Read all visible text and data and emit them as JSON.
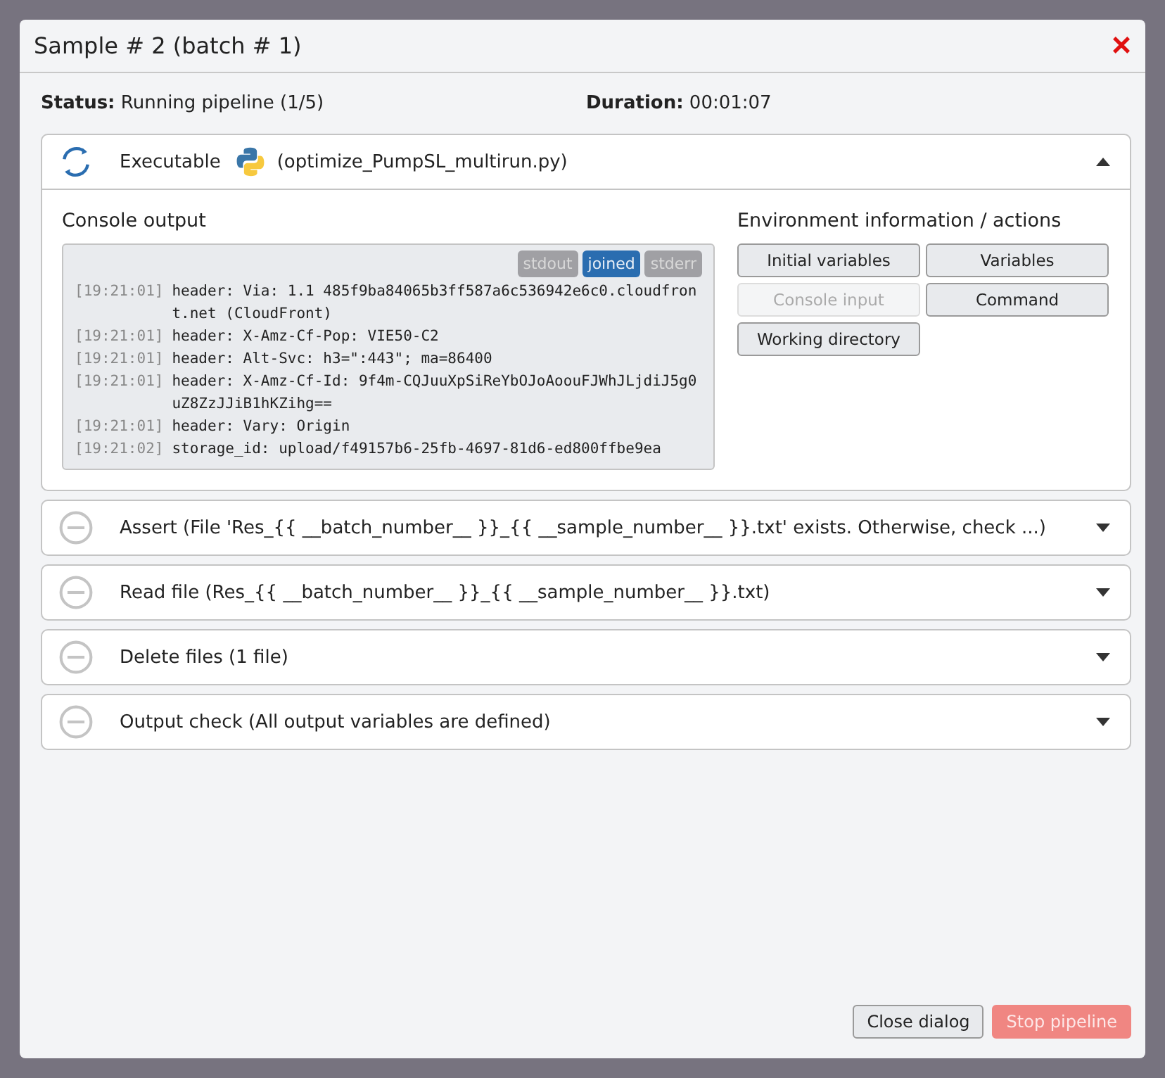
{
  "dialog": {
    "title": "Sample # 2 (batch # 1)",
    "close": "×"
  },
  "status": {
    "label": "Status:",
    "value": "Running pipeline (1/5)"
  },
  "duration": {
    "label": "Duration:",
    "value": "00:01:07"
  },
  "steps": [
    {
      "kind": "running",
      "title": "Executable",
      "file": "(optimize_PumpSL_multirun.py)",
      "python": true,
      "expanded": true
    },
    {
      "kind": "pending",
      "title": "Assert (File 'Res_{{ __batch_number__ }}_{{ __sample_number__ }}.txt' exists. Otherwise, check ...)",
      "python": false,
      "expanded": false
    },
    {
      "kind": "pending",
      "title": "Read file (Res_{{ __batch_number__ }}_{{ __sample_number__ }}.txt)",
      "python": false,
      "expanded": false
    },
    {
      "kind": "pending",
      "title": "Delete files (1 file)",
      "python": false,
      "expanded": false
    },
    {
      "kind": "pending",
      "title": "Output check (All output variables are defined)",
      "python": false,
      "expanded": false
    }
  ],
  "console": {
    "heading": "Console output",
    "streams": [
      {
        "label": "stdout",
        "selected": false
      },
      {
        "label": "joined",
        "selected": true
      },
      {
        "label": "stderr",
        "selected": false
      }
    ],
    "lines": [
      {
        "time": "[19:21:01]",
        "text": "header: Via: 1.1 485f9ba84065b3ff587a6c536942e6c0.cloudfront.net (CloudFront)"
      },
      {
        "time": "[19:21:01]",
        "text": "header: X-Amz-Cf-Pop: VIE50-C2"
      },
      {
        "time": "[19:21:01]",
        "text": "header: Alt-Svc: h3=\":443\"; ma=86400"
      },
      {
        "time": "[19:21:01]",
        "text": "header: X-Amz-Cf-Id: 9f4m-CQJuuXpSiReYbOJoAoouFJWhJLjdiJ5g0uZ8ZzJJiB1hKZihg=="
      },
      {
        "time": "[19:21:01]",
        "text": "header: Vary: Origin"
      },
      {
        "time": "[19:21:02]",
        "text": "storage_id: upload/f49157b6-25fb-4697-81d6-ed800ffbe9ea"
      }
    ]
  },
  "environment": {
    "heading": "Environment information / actions",
    "buttons": [
      {
        "label": "Initial variables",
        "disabled": false
      },
      {
        "label": "Variables",
        "disabled": false
      },
      {
        "label": "Console input",
        "disabled": true
      },
      {
        "label": "Command",
        "disabled": false
      },
      {
        "label": "Working directory",
        "disabled": false
      }
    ]
  },
  "footer": {
    "buttons": [
      {
        "label": "Close dialog",
        "kind": "secondary"
      },
      {
        "label": "Stop pipeline",
        "kind": "danger"
      }
    ]
  }
}
